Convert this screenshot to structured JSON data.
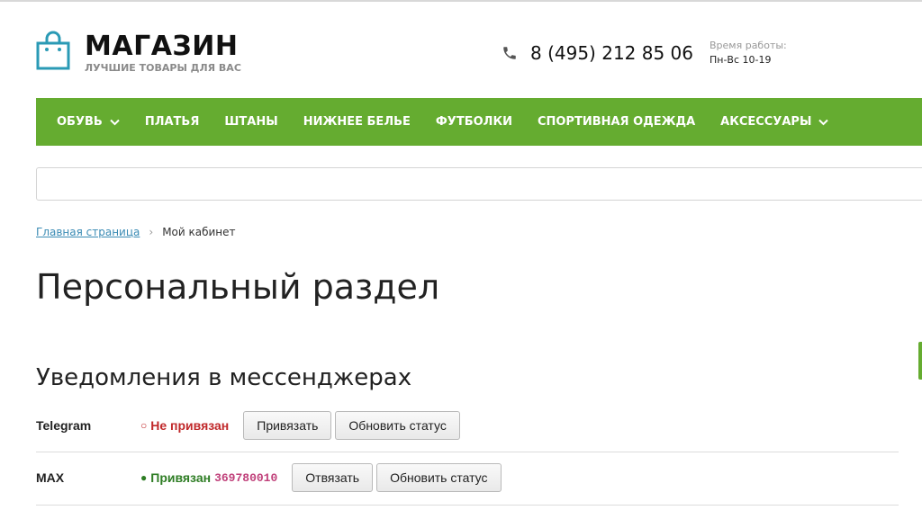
{
  "header": {
    "logo_title": "МАГАЗИН",
    "logo_subtitle": "ЛУЧШИЕ ТОВАРЫ ДЛЯ ВАС",
    "phone": "8 (495) 212 85 06",
    "hours_label": "Время работы:",
    "hours_value": "Пн-Вс 10-19"
  },
  "nav": {
    "items": [
      {
        "label": "ОБУВЬ",
        "has_dropdown": true
      },
      {
        "label": "ПЛАТЬЯ",
        "has_dropdown": false
      },
      {
        "label": "ШТАНЫ",
        "has_dropdown": false
      },
      {
        "label": "НИЖНЕЕ БЕЛЬЕ",
        "has_dropdown": false
      },
      {
        "label": "ФУТБОЛКИ",
        "has_dropdown": false
      },
      {
        "label": "СПОРТИВНАЯ ОДЕЖДА",
        "has_dropdown": false
      },
      {
        "label": "АКСЕССУАРЫ",
        "has_dropdown": true
      }
    ]
  },
  "breadcrumb": {
    "home": "Главная страница",
    "separator": "›",
    "current": "Мой кабинет"
  },
  "page": {
    "title": "Персональный раздел",
    "section_title": "Уведомления в мессенджерах"
  },
  "messengers": [
    {
      "name": "Telegram",
      "status_icon": "○",
      "status": "Не привязан",
      "chat_id": "",
      "primary_button": "Привязать",
      "refresh_button": "Обновить статус"
    },
    {
      "name": "MAX",
      "status_icon": "●",
      "status": "Привязан",
      "chat_id": "369780010",
      "primary_button": "Отвязать",
      "refresh_button": "Обновить статус"
    }
  ],
  "colors": {
    "accent_green": "#65ac30",
    "logo_teal": "#2a9ab5",
    "unlinked_red": "#c0282a",
    "linked_green": "#2e7d24",
    "link_blue": "#3a8bb4"
  },
  "icons": {
    "logo": "shopping-bag-icon",
    "phone": "phone-icon",
    "dropdown": "chevron-down-icon"
  }
}
